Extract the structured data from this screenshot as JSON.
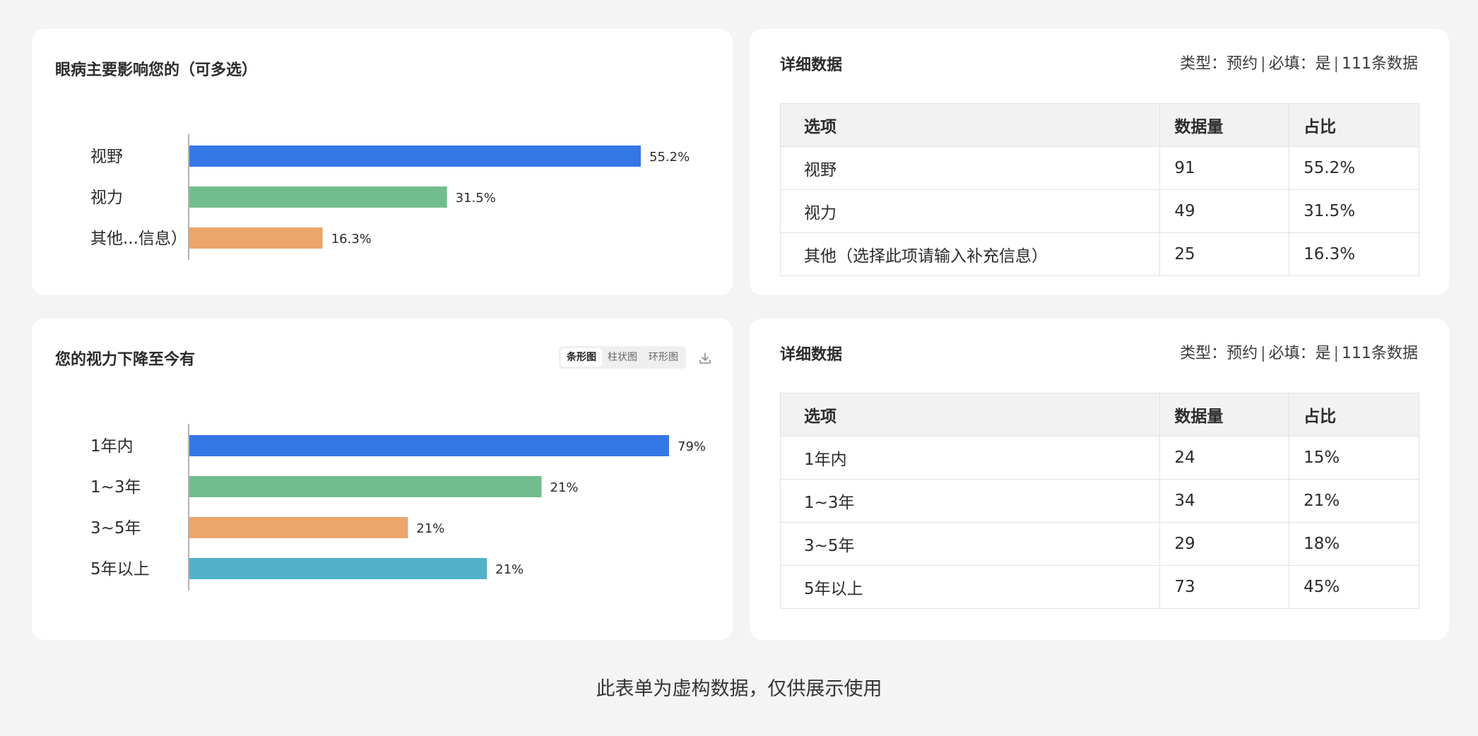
{
  "q1": {
    "chart_title": "眼病主要影响您的（可多选）",
    "chart_data": {
      "type": "bar",
      "orientation": "horizontal",
      "categories": [
        "视野",
        "视力",
        "其他...信息）"
      ],
      "values": [
        55.2,
        31.5,
        16.3
      ],
      "value_labels": [
        "55.2%",
        "31.5%",
        "16.3%"
      ],
      "colors": [
        "#3478e5",
        "#72bd8e",
        "#eca56a"
      ],
      "xlim": [
        0,
        55.2
      ]
    },
    "table_title": "详细数据",
    "meta": {
      "type": "类型：预约",
      "required": "必填：是",
      "count": "111条数据"
    },
    "headers": [
      "选项",
      "数据量",
      "占比"
    ],
    "rows": [
      [
        "视野",
        "91",
        "55.2%"
      ],
      [
        "视力",
        "49",
        "31.5%"
      ],
      [
        "其他（选择此项请输入补充信息）",
        "25",
        "16.3%"
      ]
    ]
  },
  "q2": {
    "chart_title": "您的视力下降至今有",
    "chart_types": [
      "条形图",
      "柱状图",
      "环形图"
    ],
    "active_chart_type": "条形图",
    "chart_data": {
      "type": "bar",
      "orientation": "horizontal",
      "categories": [
        "1年内",
        "1~3年",
        "3~5年",
        "5年以上"
      ],
      "values": [
        79,
        58,
        36,
        49
      ],
      "value_labels": [
        "79%",
        "21%",
        "21%",
        "21%"
      ],
      "colors": [
        "#3478e5",
        "#72bd8e",
        "#eca56a",
        "#52b1c9"
      ],
      "xlim": [
        0,
        79
      ]
    },
    "table_title": "详细数据",
    "meta": {
      "type": "类型：预约",
      "required": "必填：是",
      "count": "111条数据"
    },
    "headers": [
      "选项",
      "数据量",
      "占比"
    ],
    "rows": [
      [
        "1年内",
        "24",
        "15%"
      ],
      [
        "1~3年",
        "34",
        "21%"
      ],
      [
        "3~5年",
        "29",
        "18%"
      ],
      [
        "5年以上",
        "73",
        "45%"
      ]
    ]
  },
  "footer": "此表单为虚构数据，仅供展示使用"
}
